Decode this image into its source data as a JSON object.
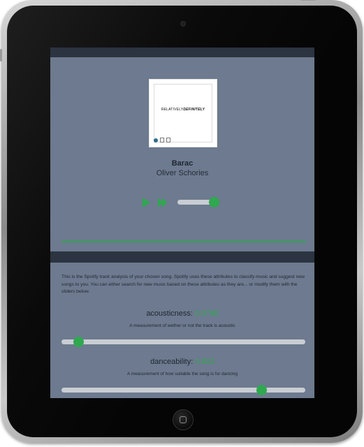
{
  "album": {
    "text_light": "RELATIVELY",
    "text_bold": "DEFINITELY"
  },
  "track": {
    "title": "Barac",
    "artist": "Oliver Schories",
    "progress": 0.9
  },
  "description": "This is the Spotify track analysis of your chosen song. Spotify uses these attributes to classify music and suggest new songs to you. You can either search for new music based on these attributes as they are... or modify them with the sliders below.",
  "attributes": [
    {
      "label": "acousticness:",
      "value": "0.0768",
      "description": "A measurement of wether or not the track is acoustic",
      "level": 0.07
    },
    {
      "label": "danceability:",
      "value": "0.822",
      "description": "A measurement of how suitable the song is for dancing",
      "level": 0.822
    }
  ],
  "colors": {
    "accent": "#2fa84f",
    "screen_bg": "#6d7a8f",
    "bar_dark": "#2b3440"
  },
  "icons": {
    "play": "play-icon",
    "next": "next-icon"
  }
}
